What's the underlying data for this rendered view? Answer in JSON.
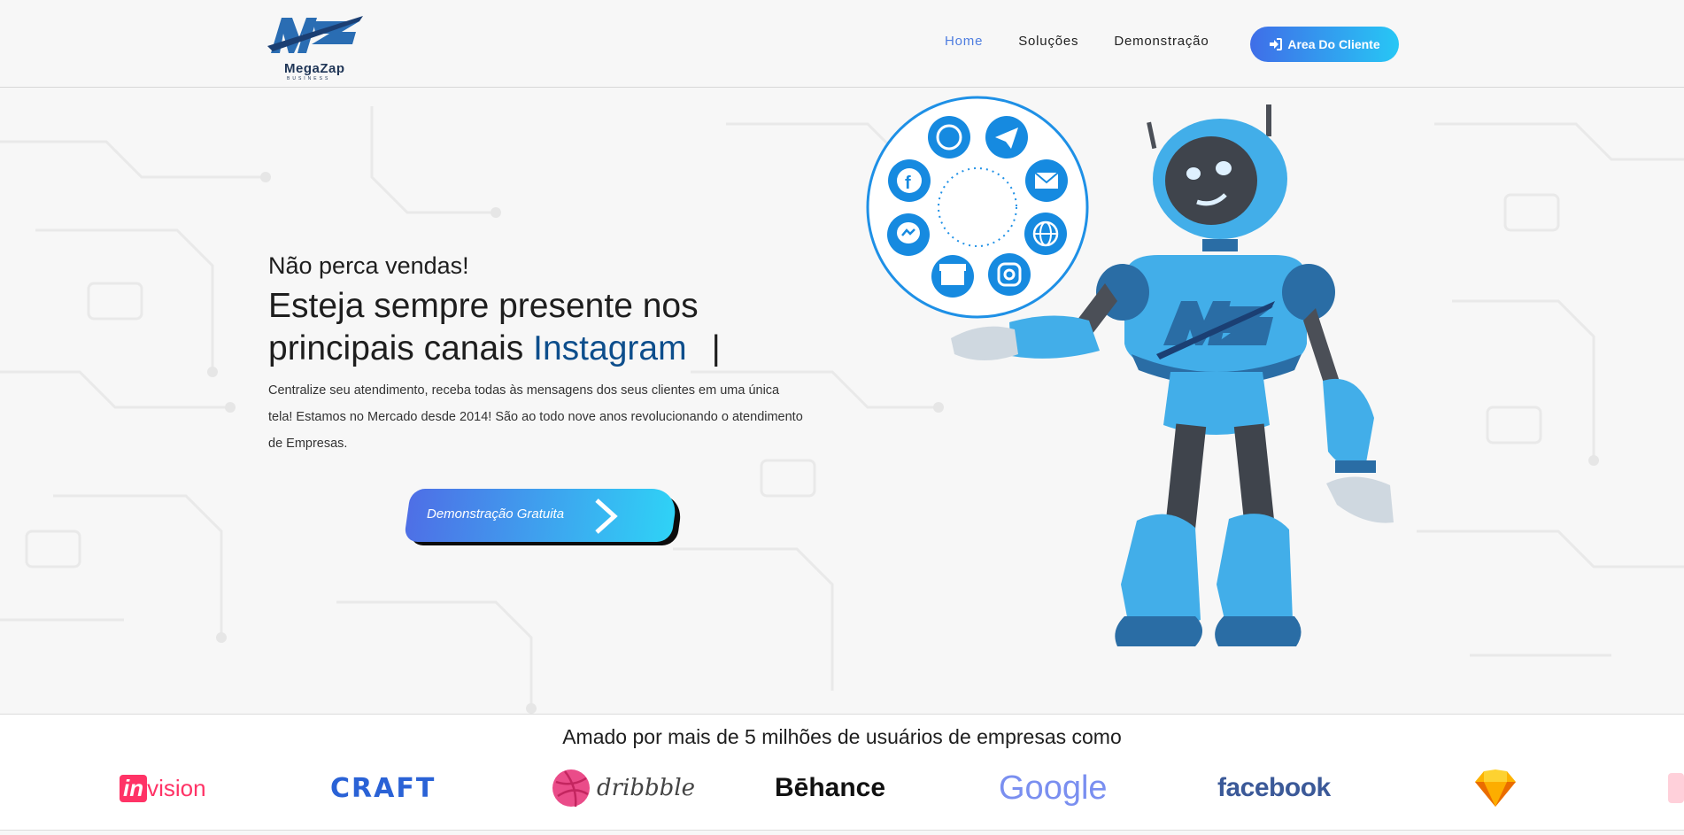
{
  "brand": {
    "name": "MegaZap",
    "tagline": "BUSINESS",
    "color": "#2c6fb2"
  },
  "nav": {
    "items": [
      {
        "label": "Home",
        "active": true
      },
      {
        "label": "Soluções",
        "active": false
      },
      {
        "label": "Demonstração",
        "active": false
      }
    ],
    "client_button": "Area Do Cliente"
  },
  "hero": {
    "kicker": "Não perca vendas!",
    "headline_line1": "Esteja sempre presente nos",
    "headline_line2_prefix": "principais canais ",
    "headline_accent": "Instagram",
    "cursor": "|",
    "description": "Centralize seu atendimento, receba todas às mensagens dos seus clientes em uma única tela! Estamos no Mercado desde 2014! São ao todo nove anos revolucionando o atendimento de Empresas.",
    "cta_label": "Demonstração Gratuita"
  },
  "channels": [
    "whatsapp-icon",
    "telegram-icon",
    "email-icon",
    "globe-icon",
    "instagram-icon",
    "google-business-icon",
    "messenger-icon",
    "facebook-icon"
  ],
  "trust": {
    "title": "Amado por mais de 5 milhões de usuários de empresas como",
    "logos": [
      {
        "name": "invision",
        "text_a": "in",
        "text_b": "vision"
      },
      {
        "name": "craft",
        "text": "CRAFT"
      },
      {
        "name": "dribbble",
        "text": "dribbble"
      },
      {
        "name": "behance",
        "text": "Bēhance"
      },
      {
        "name": "google",
        "text": "Google"
      },
      {
        "name": "facebook",
        "text": "facebook"
      },
      {
        "name": "sketch",
        "text": ""
      }
    ]
  },
  "colors": {
    "accent": "#4f7ee0",
    "gradient_start": "#3f6ee8",
    "gradient_end": "#27c7f5",
    "robot": "#42aee9"
  }
}
